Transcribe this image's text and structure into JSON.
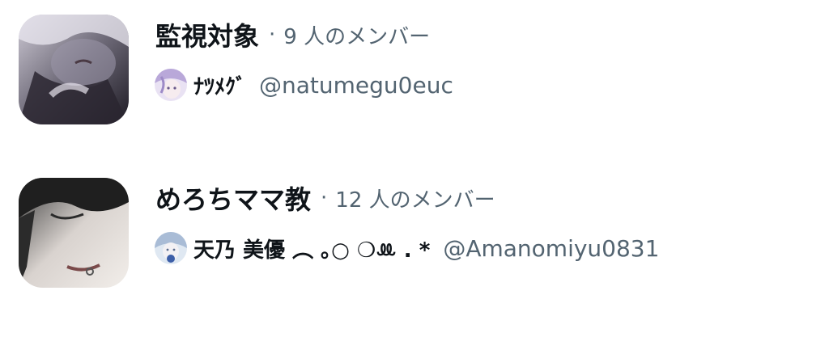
{
  "lists": [
    {
      "name": "監視対象",
      "separator": "·",
      "member_count": "9 人のメンバー",
      "owner": {
        "display_name": "ﾅﾂﾒｸﾞ",
        "handle": "@natumegu0euc"
      },
      "avatar_icon": "dark-anime-portrait",
      "owner_icon": "pastel-anime-avatar"
    },
    {
      "name": "めろちママ教",
      "separator": "·",
      "member_count": "12 人のメンバー",
      "owner": {
        "display_name": "天乃 美優 ︵ ｡○ ❍ꔛ . *",
        "handle": "@Amanomiyu0831"
      },
      "avatar_icon": "monochrome-anime-portrait",
      "owner_icon": "blue-anime-avatar"
    }
  ],
  "colors": {
    "primary_text": "#0f1419",
    "secondary_text": "#536471",
    "background": "#ffffff"
  }
}
